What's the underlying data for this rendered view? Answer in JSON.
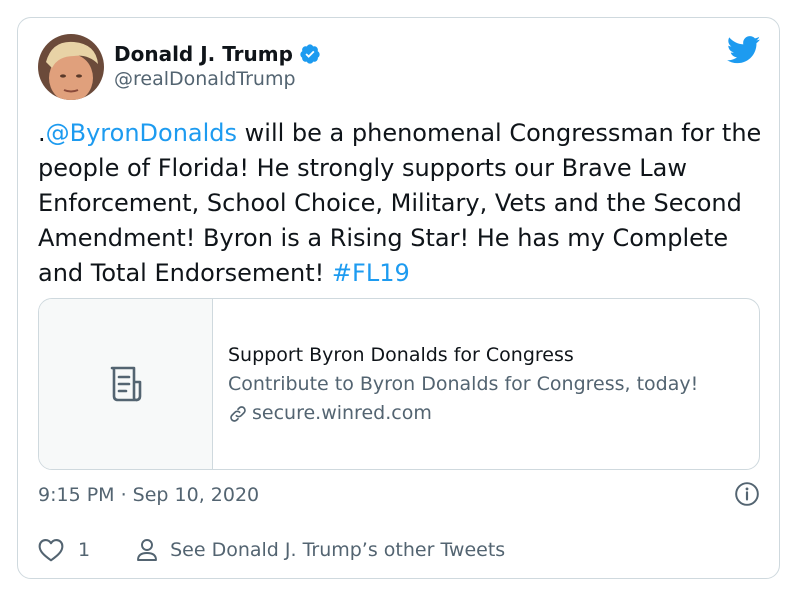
{
  "author": {
    "name": "Donald J. Trump",
    "handle": "@realDonaldTrump",
    "verified": true
  },
  "tweet": {
    "prefix": ".",
    "mention": "@ByronDonalds",
    "body": " will be a phenomenal Congressman for the people of Florida! He strongly supports our Brave Law Enforcement, School Choice, Military, Vets and the Second Amendment! Byron is a Rising Star! He has my Complete and Total Endorsement! ",
    "hashtag": "#FL19"
  },
  "link_card": {
    "title": "Support Byron Donalds for Congress",
    "description": "Contribute to Byron Donalds for Congress, today!",
    "domain": "secure.winred.com",
    "thumbnail_icon": "document-icon"
  },
  "timestamp": "9:15 PM · Sep 10, 2020",
  "actions": {
    "like_count": "1",
    "other_tweets_label": "See Donald J. Trump’s other Tweets"
  },
  "colors": {
    "accent": "#1d9bf0",
    "text": "#0f1419",
    "secondary": "#536471",
    "border": "#cfd9de"
  }
}
